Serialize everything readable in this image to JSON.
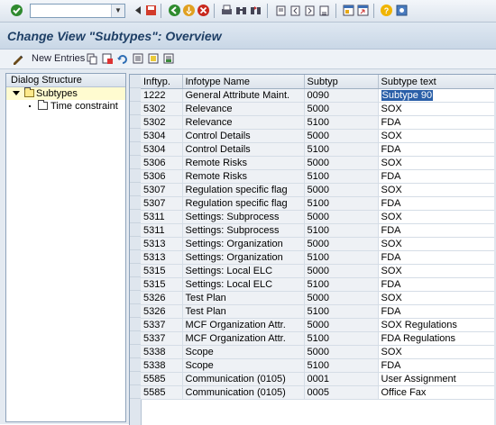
{
  "colors": {
    "accent": "#1e3f66",
    "selection": "#2a5fa8",
    "tree_selected": "#fffbd0"
  },
  "toolbar": {
    "command_field_value": "",
    "icons": [
      "check-icon",
      "save-icon",
      "back-icon",
      "exit-icon",
      "cancel-icon",
      "print-icon",
      "find-icon",
      "find-next-icon",
      "first-page-icon",
      "previous-page-icon",
      "next-page-icon",
      "last-page-icon",
      "new-session-icon",
      "shortcut-icon",
      "help-icon"
    ]
  },
  "title": "Change View \"Subtypes\": Overview",
  "app_toolbar": {
    "new_entries_label": "New Entries"
  },
  "dialog_structure": {
    "header": "Dialog Structure",
    "items": [
      {
        "label": "Subtypes",
        "selected": true
      },
      {
        "label": "Time constraint",
        "selected": false
      }
    ]
  },
  "table": {
    "columns": [
      "Inftyp.",
      "Infotype Name",
      "Subtyp",
      "Subtype text"
    ],
    "rows": [
      [
        "1222",
        "General Attribute Maint.",
        "0090",
        "Subtype 90"
      ],
      [
        "5302",
        "Relevance",
        "5000",
        "SOX"
      ],
      [
        "5302",
        "Relevance",
        "5100",
        "FDA"
      ],
      [
        "5304",
        "Control Details",
        "5000",
        "SOX"
      ],
      [
        "5304",
        "Control Details",
        "5100",
        "FDA"
      ],
      [
        "5306",
        "Remote Risks",
        "5000",
        "SOX"
      ],
      [
        "5306",
        "Remote Risks",
        "5100",
        "FDA"
      ],
      [
        "5307",
        "Regulation specific flag",
        "5000",
        "SOX"
      ],
      [
        "5307",
        "Regulation specific flag",
        "5100",
        "FDA"
      ],
      [
        "5311",
        "Settings: Subprocess",
        "5000",
        "SOX"
      ],
      [
        "5311",
        "Settings: Subprocess",
        "5100",
        "FDA"
      ],
      [
        "5313",
        "Settings: Organization",
        "5000",
        "SOX"
      ],
      [
        "5313",
        "Settings: Organization",
        "5100",
        "FDA"
      ],
      [
        "5315",
        "Settings: Local ELC",
        "5000",
        "SOX"
      ],
      [
        "5315",
        "Settings: Local ELC",
        "5100",
        "FDA"
      ],
      [
        "5326",
        "Test Plan",
        "5000",
        "SOX"
      ],
      [
        "5326",
        "Test Plan",
        "5100",
        "FDA"
      ],
      [
        "5337",
        "MCF Organization Attr.",
        "5000",
        "SOX Regulations"
      ],
      [
        "5337",
        "MCF Organization Attr.",
        "5100",
        "FDA Regulations"
      ],
      [
        "5338",
        "Scope",
        "5000",
        "SOX"
      ],
      [
        "5338",
        "Scope",
        "5100",
        "FDA"
      ],
      [
        "5585",
        "Communication (0105)",
        "0001",
        "User Assignment"
      ],
      [
        "5585",
        "Communication (0105)",
        "0005",
        "Office Fax"
      ]
    ]
  }
}
